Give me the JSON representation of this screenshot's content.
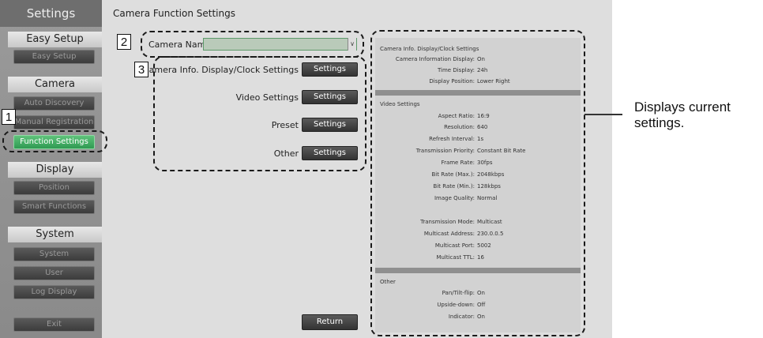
{
  "sidebar": {
    "title": "Settings",
    "sections": [
      {
        "header": "Easy Setup",
        "items": [
          "Easy Setup"
        ]
      },
      {
        "header": "Camera",
        "items": [
          "Auto Discovery",
          "Manual Registration",
          "Function Settings"
        ]
      },
      {
        "header": "Display",
        "items": [
          "Position",
          "Smart Functions"
        ]
      },
      {
        "header": "System",
        "items": [
          "System",
          "User",
          "Log Display"
        ]
      }
    ],
    "exit": "Exit"
  },
  "main": {
    "title": "Camera Function Settings",
    "camera_name_label": "Camera Name",
    "camera_name_value": "",
    "rows": [
      {
        "label": "Camera Info. Display/Clock Settings",
        "button": "Settings"
      },
      {
        "label": "Video Settings",
        "button": "Settings"
      },
      {
        "label": "Preset",
        "button": "Settings"
      },
      {
        "label": "Other",
        "button": "Settings"
      }
    ],
    "return": "Return"
  },
  "info": {
    "sections": [
      {
        "title": "Camera Info. Display/Clock Settings",
        "items": [
          {
            "k": "Camera Information Display:",
            "v": "On"
          },
          {
            "k": "Time Display:",
            "v": "24h"
          },
          {
            "k": "Display Position:",
            "v": "Lower Right"
          }
        ]
      },
      {
        "title": "Video Settings",
        "items": [
          {
            "k": "Aspect Ratio:",
            "v": "16:9"
          },
          {
            "k": "Resolution:",
            "v": "640"
          },
          {
            "k": "Refresh Interval:",
            "v": "1s"
          },
          {
            "k": "Transmission Priority:",
            "v": "Constant Bit Rate"
          },
          {
            "k": "Frame Rate:",
            "v": "30fps"
          },
          {
            "k": "Bit Rate (Max.):",
            "v": "2048kbps"
          },
          {
            "k": "Bit Rate (Min.):",
            "v": "128kbps"
          },
          {
            "k": "Image Quality:",
            "v": "Normal"
          },
          {
            "k": "Transmission Mode:",
            "v": "Multicast"
          },
          {
            "k": "Multicast Address:",
            "v": "230.0.0.5"
          },
          {
            "k": "Multicast Port:",
            "v": "5002"
          },
          {
            "k": "Multicast TTL:",
            "v": "16"
          }
        ]
      },
      {
        "title": "Other",
        "items": [
          {
            "k": "Pan/Tilt-flip:",
            "v": "On"
          },
          {
            "k": "Upside-down:",
            "v": "Off"
          },
          {
            "k": "Indicator:",
            "v": "On"
          }
        ]
      }
    ]
  },
  "annotations": {
    "n1": "1",
    "n2": "2",
    "n3": "3",
    "callout": [
      "Displays current",
      "settings."
    ]
  }
}
